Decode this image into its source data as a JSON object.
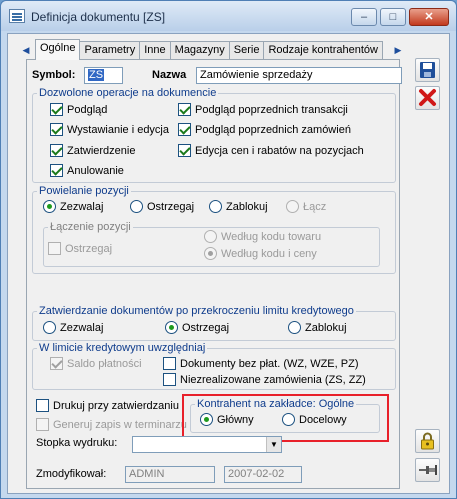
{
  "window": {
    "title": "Definicja dokumentu [ZS]",
    "controls": {
      "minimize": "–",
      "maximize": "□",
      "close": "✕"
    }
  },
  "tabs": [
    {
      "label": "Ogólne",
      "active": true
    },
    {
      "label": "Parametry"
    },
    {
      "label": "Inne"
    },
    {
      "label": "Magazyny"
    },
    {
      "label": "Serie"
    },
    {
      "label": "Rodzaje kontrahentów"
    }
  ],
  "header": {
    "symbol_label": "Symbol:",
    "symbol_value": "ZS",
    "nazwa_label": "Nazwa",
    "nazwa_value": "Zamówienie sprzedaży"
  },
  "operations": {
    "title": "Dozwolone operacje na dokumencie",
    "items": [
      {
        "label": "Podgląd",
        "checked": true
      },
      {
        "label": "Wystawianie i edycja",
        "checked": true
      },
      {
        "label": "Zatwierdzenie",
        "checked": true
      },
      {
        "label": "Anulowanie",
        "checked": true
      },
      {
        "label": "Podgląd poprzednich transakcji",
        "checked": true
      },
      {
        "label": "Podgląd poprzednich zamówień",
        "checked": true
      },
      {
        "label": "Edycja cen i rabatów na pozycjach",
        "checked": true
      }
    ]
  },
  "duplication": {
    "title": "Powielanie pozycji",
    "options": [
      {
        "label": "Zezwalaj",
        "selected": true
      },
      {
        "label": "Ostrzegaj"
      },
      {
        "label": "Zablokuj"
      },
      {
        "label": "Łącz",
        "disabled": true
      }
    ],
    "merge_group": {
      "title": "Łączenie pozycji",
      "warn_label": "Ostrzegaj",
      "by_code": "Według kodu towaru",
      "by_code_price": "Według kodu i ceny"
    }
  },
  "credit": {
    "title": "Zatwierdzanie dokumentów po przekroczeniu limitu kredytowego",
    "options": [
      {
        "label": "Zezwalaj"
      },
      {
        "label": "Ostrzegaj",
        "selected": true
      },
      {
        "label": "Zablokuj"
      }
    ]
  },
  "credit_limit": {
    "title": "W limicie kredytowym uwzględniaj",
    "payments_balance": "Saldo płatności",
    "unpaid_docs": "Dokumenty bez płat. (WZ, WZE, PZ)",
    "unrealized_orders": "Niezrealizowane zamówienia (ZS, ZZ)"
  },
  "print_on_approve": "Drukuj przy zatwierdzaniu",
  "generate_schedule": "Generuj zapis w terminarzu",
  "contractor_tab": {
    "title": "Kontrahent na zakładce: Ogólne",
    "main": "Główny",
    "target": "Docelowy"
  },
  "footer_select": {
    "label": "Stopka wydruku:",
    "value": ""
  },
  "modified": {
    "label": "Zmodyfikował:",
    "user": "ADMIN",
    "date": "2007-02-02"
  },
  "toolbar": {
    "save_icon": "save-icon",
    "cancel_icon": "cancel-icon",
    "lock_icon": "lock-icon",
    "pin_icon": "pin-icon"
  },
  "colors": {
    "accent": "#0f3c8c",
    "highlight": "#e8202a",
    "window_frame": "#c4d8ee"
  }
}
